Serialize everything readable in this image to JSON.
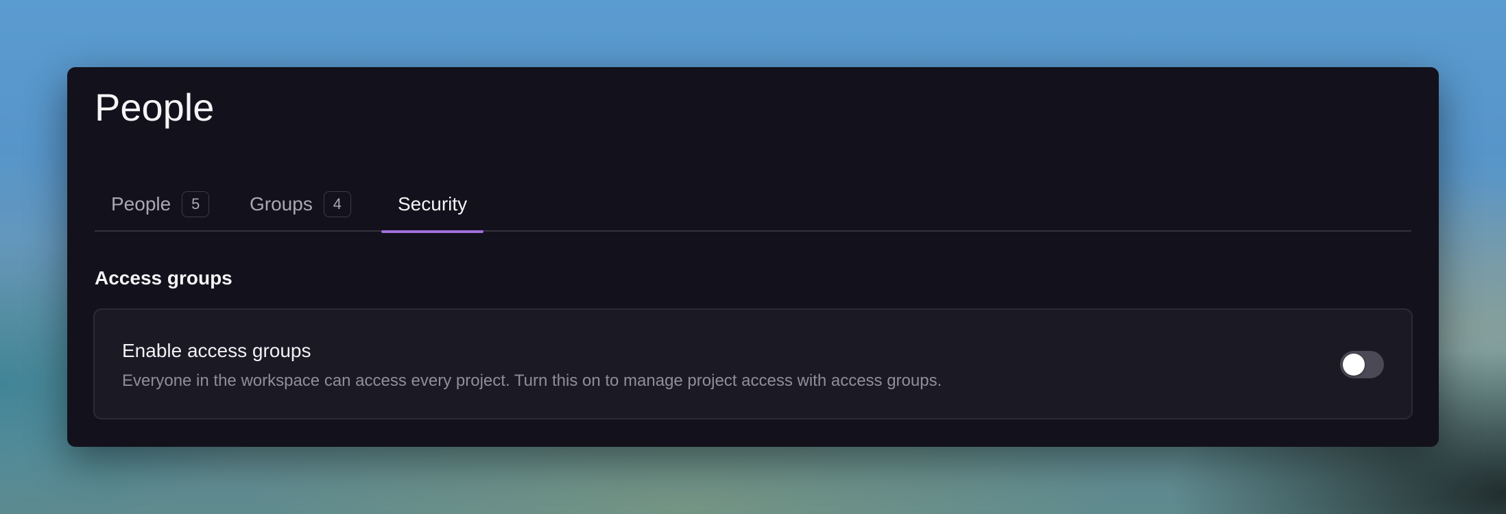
{
  "header": {
    "title": "People"
  },
  "tabs": [
    {
      "label": "People",
      "count": "5",
      "active": false
    },
    {
      "label": "Groups",
      "count": "4",
      "active": false
    },
    {
      "label": "Security",
      "count": null,
      "active": true
    }
  ],
  "security": {
    "section_title": "Access groups",
    "setting": {
      "title": "Enable access groups",
      "description": "Everyone in the workspace can access every project. Turn this on to manage project access with access groups.",
      "enabled": false
    }
  },
  "colors": {
    "accent": "#a06fe0",
    "panel_bg": "#13121c",
    "card_bg": "#1a1924"
  }
}
